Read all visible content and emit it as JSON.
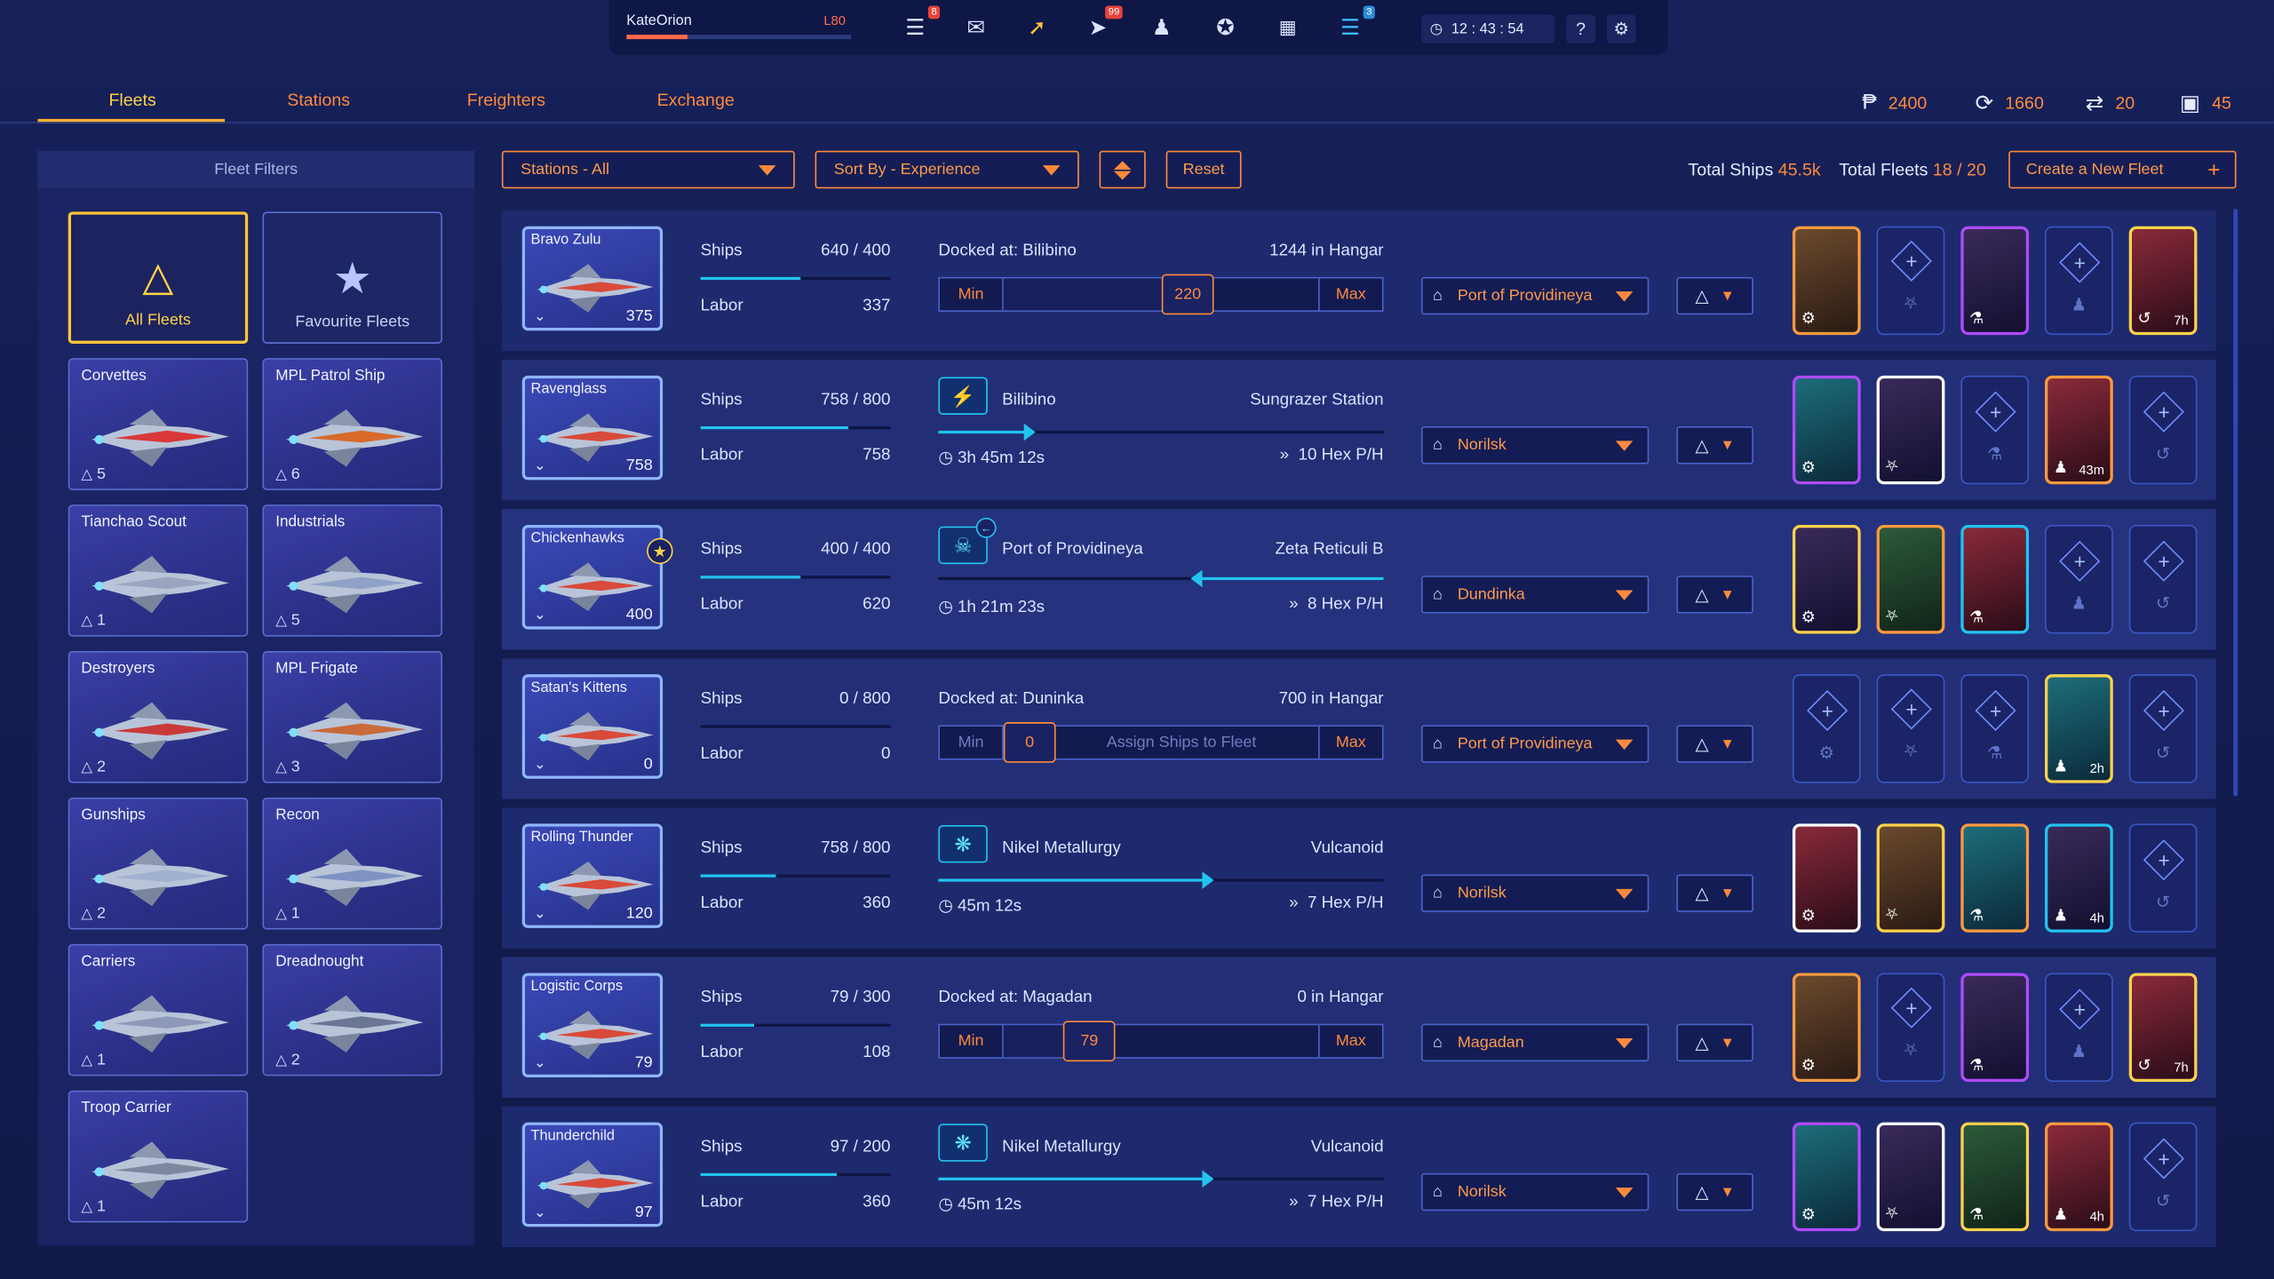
{
  "topbar": {
    "username": "KateOrion",
    "level": "L80",
    "xp_fraction": 0.27,
    "badges": {
      "log": "8",
      "market": "99",
      "fleet": "3"
    },
    "clock": "12 : 43 : 54",
    "help": "?"
  },
  "nav": {
    "tabs": [
      "Fleets",
      "Stations",
      "Freighters",
      "Exchange"
    ],
    "active": "Fleets"
  },
  "resources": {
    "credits": "2400",
    "cycles": "1660",
    "transfers": "20",
    "slots": "45"
  },
  "sidebar": {
    "title": "Fleet Filters",
    "all_fleets": "All Fleets",
    "favourites": "Favourite Fleets",
    "tiles": [
      {
        "name": "Corvettes",
        "count": "5"
      },
      {
        "name": "MPL Patrol Ship",
        "count": "6"
      },
      {
        "name": "Tianchao Scout",
        "count": "1"
      },
      {
        "name": "Industrials",
        "count": "5"
      },
      {
        "name": "Destroyers",
        "count": "2"
      },
      {
        "name": "MPL Frigate",
        "count": "3"
      },
      {
        "name": "Gunships",
        "count": "2"
      },
      {
        "name": "Recon",
        "count": "1"
      },
      {
        "name": "Carriers",
        "count": "1"
      },
      {
        "name": "Dreadnought",
        "count": "2"
      },
      {
        "name": "Troop Carrier",
        "count": "1"
      }
    ]
  },
  "controls": {
    "station_filter": "Stations - All",
    "sort": "Sort By - Experience",
    "reset": "Reset",
    "total_ships_label": "Total Ships",
    "total_ships": "45.5k",
    "total_fleets_label": "Total Fleets",
    "total_fleets": "18 / 20",
    "create": "Create a New Fleet",
    "create_plus": "+"
  },
  "labels": {
    "ships": "Ships",
    "labor": "Labor",
    "min": "Min",
    "max": "Max",
    "assign": "Assign Ships to Fleet"
  },
  "fleets": [
    {
      "name": "Bravo Zulu",
      "count": "375",
      "ships": "640 / 400",
      "ships_fill": 0.53,
      "labor": "337",
      "status": "docked",
      "docked": "Docked at: Bilibino",
      "hangar": "1244 in Hangar",
      "slider": "220",
      "slider_pos": 0.58,
      "station": "Port of Providineya"
    },
    {
      "name": "Ravenglass",
      "count": "758",
      "ships": "758 / 800",
      "ships_fill": 0.78,
      "labor": "758",
      "status": "travel",
      "from": "Bilibino",
      "to": "Sungrazer Station",
      "eta": "3h 45m 12s",
      "speed": "10 Hex P/H",
      "progress": 0.2,
      "station": "Norilsk"
    },
    {
      "name": "Chickenhawks",
      "count": "400",
      "ships": "400 / 400",
      "ships_fill": 0.53,
      "labor": "620",
      "status": "travel",
      "from": "Port of Providineya",
      "to": "Zeta Reticuli B",
      "eta": "1h 21m 23s",
      "speed": "8 Hex P/H",
      "progress": 0.58,
      "station": "Dundinka",
      "favourite": true
    },
    {
      "name": "Satan's Kittens",
      "count": "0",
      "ships": "0 / 800",
      "ships_fill": 0,
      "labor": "0",
      "status": "docked",
      "docked": "Docked at: Duninka",
      "hangar": "700 in Hangar",
      "slider": "0",
      "slider_pos": 0.0,
      "station": "Port of Providineya"
    },
    {
      "name": "Rolling Thunder",
      "count": "120",
      "ships": "758 / 800",
      "ships_fill": 0.4,
      "labor": "360",
      "status": "travel",
      "from": "Nikel Metallurgy",
      "to": "Vulcanoid",
      "eta": "45m 12s",
      "speed": "7 Hex P/H",
      "progress": 0.6,
      "station": "Norilsk"
    },
    {
      "name": "Logistic Corps",
      "count": "79",
      "ships": "79 / 300",
      "ships_fill": 0.28,
      "labor": "108",
      "status": "docked",
      "docked": "Docked at: Magadan",
      "hangar": "0 in Hangar",
      "slider": "79",
      "slider_pos": 0.27,
      "station": "Magadan"
    },
    {
      "name": "Thunderchild",
      "count": "97",
      "ships": "97 / 200",
      "ships_fill": 0.72,
      "labor": "360",
      "status": "travel",
      "from": "Nikel Metallurgy",
      "to": "Vulcanoid",
      "eta": "45m 12s",
      "speed": "7 Hex P/H",
      "progress": 0.6,
      "station": "Norilsk"
    }
  ],
  "cards": [
    [
      {
        "filled": true,
        "time": ""
      },
      {
        "filled": false
      },
      {
        "filled": true,
        "time": ""
      },
      {
        "filled": false
      },
      {
        "filled": true,
        "time": "7h"
      }
    ],
    [
      {
        "filled": true,
        "time": ""
      },
      {
        "filled": true,
        "time": ""
      },
      {
        "filled": false
      },
      {
        "filled": true,
        "time": "43m"
      },
      {
        "filled": false
      }
    ],
    [
      {
        "filled": true,
        "time": ""
      },
      {
        "filled": true,
        "time": ""
      },
      {
        "filled": true,
        "time": ""
      },
      {
        "filled": false
      },
      {
        "filled": false
      }
    ],
    [
      {
        "filled": false
      },
      {
        "filled": false
      },
      {
        "filled": false
      },
      {
        "filled": true,
        "time": "2h"
      },
      {
        "filled": false
      }
    ],
    [
      {
        "filled": true,
        "time": ""
      },
      {
        "filled": true,
        "time": ""
      },
      {
        "filled": true,
        "time": ""
      },
      {
        "filled": true,
        "time": "4h"
      },
      {
        "filled": false
      }
    ],
    [
      {
        "filled": true,
        "time": ""
      },
      {
        "filled": false
      },
      {
        "filled": true,
        "time": ""
      },
      {
        "filled": false
      },
      {
        "filled": true,
        "time": "7h"
      }
    ],
    [
      {
        "filled": true,
        "time": ""
      },
      {
        "filled": true,
        "time": ""
      },
      {
        "filled": true,
        "time": ""
      },
      {
        "filled": true,
        "time": "4h"
      },
      {
        "filled": false
      }
    ]
  ],
  "colors": {
    "accent": "#ff8a3c",
    "active_tab": "#ffd24a",
    "progress": "#22c3ef",
    "panel": "#1e2a6e"
  }
}
